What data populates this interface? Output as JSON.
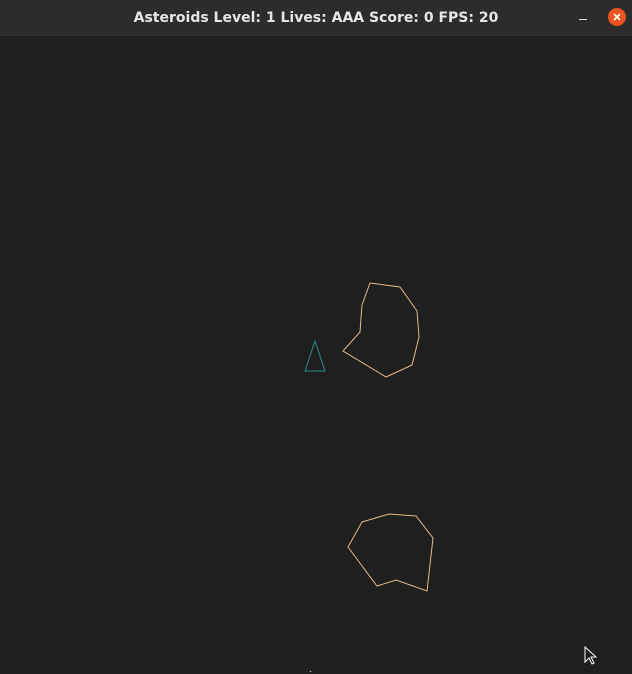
{
  "window": {
    "title": "Asteroids Level: 1 Lives: AAA Score: 0 FPS: 20"
  },
  "controls": {
    "minimize_icon": "minimize-icon",
    "close_icon": "close-icon"
  },
  "colors": {
    "background": "#1f1f1f",
    "titlebar": "#2c2c2c",
    "ship": "#2a8c8c",
    "asteroid": "#e8b98a",
    "close": "#e95420"
  },
  "game": {
    "level": 1,
    "lives": "AAA",
    "score": 0,
    "fps": 20
  }
}
